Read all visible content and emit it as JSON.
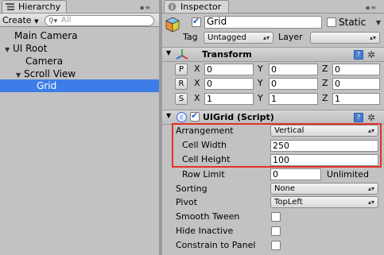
{
  "hierarchy": {
    "tab_label": "Hierarchy",
    "create_label": "Create",
    "search_placeholder": "All",
    "items": [
      {
        "label": "Main Camera"
      },
      {
        "label": "UI Root"
      },
      {
        "label": "Camera"
      },
      {
        "label": "Scroll View"
      },
      {
        "label": "Grid"
      }
    ]
  },
  "inspector": {
    "tab_label": "Inspector",
    "object_name": "Grid",
    "static_label": "Static",
    "tag_label": "Tag",
    "tag_value": "Untagged",
    "layer_label": "Layer",
    "layer_value": "",
    "transform": {
      "title": "Transform",
      "rows": [
        {
          "button": "P",
          "x": "0",
          "y": "0",
          "z": "0"
        },
        {
          "button": "R",
          "x": "0",
          "y": "0",
          "z": "0"
        },
        {
          "button": "S",
          "x": "1",
          "y": "1",
          "z": "1"
        }
      ],
      "axis_x": "X",
      "axis_y": "Y",
      "axis_z": "Z"
    },
    "uigrid": {
      "title": "UIGrid (Script)",
      "arrangement_label": "Arrangement",
      "arrangement_value": "Vertical",
      "cell_width_label": "Cell Width",
      "cell_width_value": "250",
      "cell_height_label": "Cell Height",
      "cell_height_value": "100",
      "row_limit_label": "Row Limit",
      "row_limit_value": "0",
      "row_limit_note": "Unlimited",
      "sorting_label": "Sorting",
      "sorting_value": "None",
      "pivot_label": "Pivot",
      "pivot_value": "TopLeft",
      "smooth_tween_label": "Smooth Tween",
      "hide_inactive_label": "Hide Inactive",
      "constrain_label": "Constrain to Panel"
    }
  },
  "colors": {
    "selection": "#3e7de7",
    "highlight": "#e0312b",
    "panel_bg": "#c2c2c2"
  }
}
